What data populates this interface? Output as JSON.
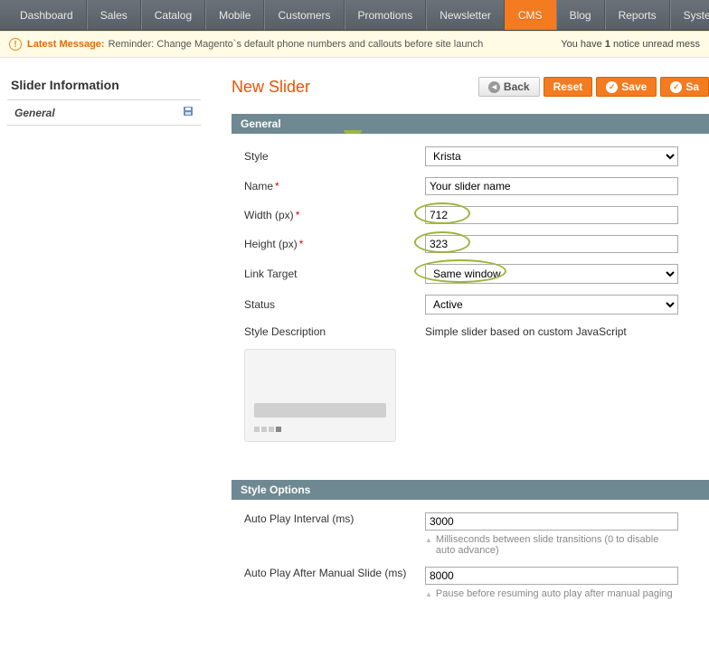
{
  "nav": {
    "items": [
      "Dashboard",
      "Sales",
      "Catalog",
      "Mobile",
      "Customers",
      "Promotions",
      "Newsletter",
      "CMS",
      "Blog",
      "Reports",
      "Syste"
    ],
    "active_index": 7
  },
  "message_bar": {
    "label": "Latest Message:",
    "text": "Reminder: Change Magento`s default phone numbers and callouts before site launch",
    "right_prefix": "You have ",
    "notice_count": "1",
    "right_suffix": " notice unread mess"
  },
  "sidebar": {
    "title": "Slider Information",
    "items": [
      {
        "label": "General"
      }
    ]
  },
  "page": {
    "title": "New Slider",
    "buttons": {
      "back": "Back",
      "reset": "Reset",
      "save": "Save",
      "save_and": "Sa"
    }
  },
  "panels": {
    "general": {
      "title": "General",
      "fields": {
        "style_label": "Style",
        "style_value": "Krista",
        "name_label": "Name",
        "name_value": "Your slider name",
        "width_label": "Width (px)",
        "width_value": "712",
        "height_label": "Height (px)",
        "height_value": "323",
        "link_target_label": "Link Target",
        "link_target_value": "Same window",
        "status_label": "Status",
        "status_value": "Active",
        "style_desc_label": "Style Description",
        "style_desc_value": "Simple slider based on custom JavaScript"
      }
    },
    "style_options": {
      "title": "Style Options",
      "fields": {
        "autoplay_label": "Auto Play Interval (ms)",
        "autoplay_value": "3000",
        "autoplay_hint": "Milliseconds between slide transitions (0 to disable auto advance)",
        "after_manual_label": "Auto Play After Manual Slide (ms)",
        "after_manual_value": "8000",
        "after_manual_hint": "Pause before resuming auto play after manual paging"
      }
    }
  }
}
